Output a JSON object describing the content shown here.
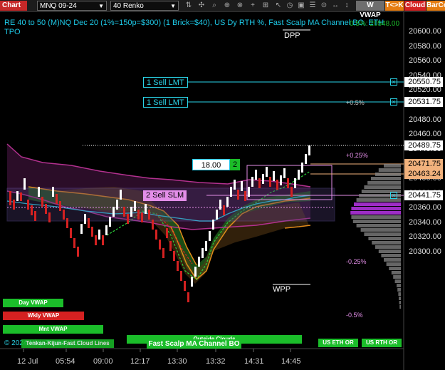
{
  "toolbar": {
    "chart_label": "Chart",
    "instrument": "MNQ 09-24",
    "bar_type": "40 Renko",
    "tools": [
      "pointer",
      "crosshair",
      "zoom",
      "draw",
      "text",
      "line",
      "marker",
      "cursor",
      "clock",
      "tool",
      "list",
      "zoom-in",
      "ruler",
      "ticker"
    ],
    "pills": [
      {
        "label": "W VWAP",
        "color": "#6e6e6e"
      },
      {
        "label": "T<>K",
        "color": "#e57c10"
      },
      {
        "label": "Cloud",
        "color": "#d42121"
      },
      {
        "label": "BarCo",
        "color": "#e57c10"
      }
    ]
  },
  "header": {
    "line1": "RE 40 to 50 (M)NQ Dec 20 (1%=150p=$300) (1 Brick=$40), US Dy RTH %, Fast Scalp MA Channel BO, ETH",
    "line2": "TPO",
    "overlay": "0.5%: 20548.00"
  },
  "price_axis": {
    "ticks": [
      "20600.00",
      "20580.00",
      "20560.00",
      "20540.00",
      "20520.00",
      "20500.00",
      "20480.00",
      "20460.00",
      "20440.00",
      "20420.00",
      "20400.00",
      "20380.00",
      "20360.00",
      "20340.00",
      "20320.00",
      "20300.00"
    ],
    "labels": [
      {
        "value": "20550.75",
        "color": "#ffffff"
      },
      {
        "value": "20531.75",
        "color": "#ffffff"
      },
      {
        "value": "20489.75",
        "color": "#ffffff"
      },
      {
        "value": "20471.75",
        "color": "#f2b27d"
      },
      {
        "value": "20463.24",
        "color": "#f2b27d"
      },
      {
        "value": "20441.75",
        "color": "#ffffff"
      }
    ]
  },
  "orders": [
    {
      "label": "1 Sell LMT",
      "price": "20550.75"
    },
    {
      "label": "1 Sell LMT",
      "price": "20531.75"
    },
    {
      "label": "2 Sell SLM",
      "price": "20441.75"
    }
  ],
  "order_entry": {
    "price": "18.00",
    "qty": "2"
  },
  "levels": {
    "dpp": "DPP",
    "wpp": "WPP"
  },
  "percent_labels": [
    "+0.5%",
    "+0.25%",
    "-0.25%",
    "-0.5%"
  ],
  "x_axis": [
    "12 Jul",
    "05:54",
    "09:00",
    "12:17",
    "13:30",
    "13:32",
    "14:31",
    "14:45"
  ],
  "indicator_buttons": [
    {
      "label": "Day VWAP",
      "color": "#1bbd2a"
    },
    {
      "label": "Wkly VWAP",
      "color": "#d42121"
    },
    {
      "label": "Mnt VWAP",
      "color": "#1bbd2a"
    },
    {
      "label": "Outside Clouds",
      "color": "#1bbd2a"
    },
    {
      "label": "Fast Scalp MA Channel BO",
      "color": "#1bbd2a"
    },
    {
      "label": "US ETH OR",
      "color": "#1bbd2a"
    },
    {
      "label": "US RTH OR",
      "color": "#1bbd2a"
    }
  ],
  "footer_text": "© 2024 NinjaTrader, LLC",
  "footer_overlay": "Tenkan-Kijun-Fast Cloud Lines",
  "colors": {
    "accent": "#1ec8e6",
    "up": "#ffffff",
    "down": "#d42121",
    "cloud_green": "#1f5a1a",
    "cloud_purple": "#4a1440"
  }
}
